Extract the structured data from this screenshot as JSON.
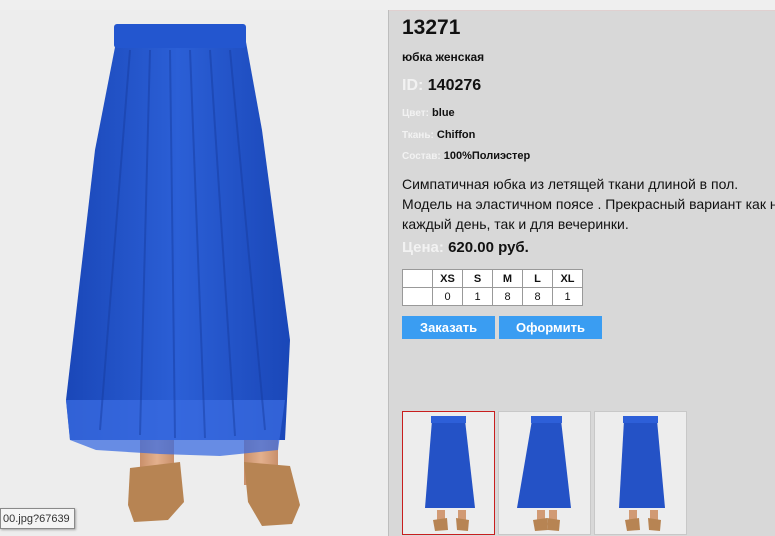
{
  "product": {
    "code": "13271",
    "name": "юбка женская",
    "id_label": "ID:",
    "id_value": "140276",
    "attributes": [
      {
        "label": "Цвет:",
        "value": "blue"
      },
      {
        "label": "Ткань:",
        "value": "Chiffon"
      },
      {
        "label": "Состав:",
        "value": "100%Полиэстер"
      }
    ],
    "description_lines": [
      "Симпатичная юбка из летящей ткани длиной в пол.",
      "Модель на эластичном поясе . Прекрасный вариант как на",
      "каждый день, так и для вечеринки."
    ],
    "price_label": "Цена:",
    "price_value": "620.00 руб.",
    "color_hex": "#1f4fc0"
  },
  "sizes": {
    "headers": [
      "XS",
      "S",
      "M",
      "L",
      "XL"
    ],
    "stock": [
      "0",
      "1",
      "8",
      "8",
      "1"
    ]
  },
  "buttons": {
    "order": "Заказать",
    "checkout": "Оформить"
  },
  "thumbnails": {
    "count": 3,
    "selected_index": 0,
    "views": [
      "front",
      "side",
      "back"
    ]
  },
  "tooltip": {
    "text": "00.jpg?67639"
  },
  "colors": {
    "accent_button": "#3a9df2",
    "label_text": "#f2f2f2",
    "selected_thumb_border": "#c81e1e",
    "panel_bg": "#d8d8d8"
  }
}
